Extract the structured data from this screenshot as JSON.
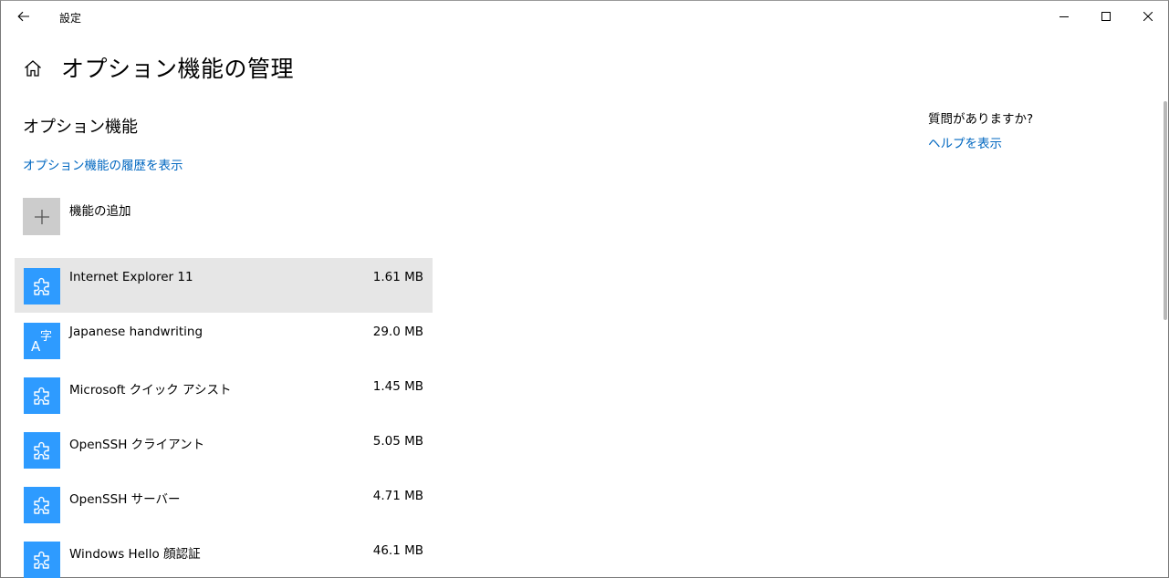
{
  "window": {
    "title": "設定",
    "controls": {
      "minimize_icon": "minimize-icon",
      "maximize_icon": "maximize-icon",
      "close_icon": "close-icon"
    }
  },
  "page": {
    "title": "オプション機能の管理",
    "section_title": "オプション機能",
    "history_link": "オプション機能の履歴を表示",
    "add_feature_label": "機能の追加"
  },
  "features": [
    {
      "name": "Internet Explorer 11",
      "size": "1.61 MB",
      "icon": "puzzle-icon",
      "selected": true
    },
    {
      "name": "Japanese handwriting",
      "size": "29.0 MB",
      "icon": "language-icon",
      "selected": false
    },
    {
      "name": "Microsoft クイック アシスト",
      "size": "1.45 MB",
      "icon": "puzzle-icon",
      "selected": false
    },
    {
      "name": "OpenSSH クライアント",
      "size": "5.05 MB",
      "icon": "puzzle-icon",
      "selected": false
    },
    {
      "name": "OpenSSH サーバー",
      "size": "4.71 MB",
      "icon": "puzzle-icon",
      "selected": false
    },
    {
      "name": "Windows Hello 顔認証",
      "size": "46.1 MB",
      "icon": "puzzle-icon",
      "selected": false
    }
  ],
  "help": {
    "title": "質問がありますか?",
    "link": "ヘルプを表示"
  },
  "colors": {
    "accent": "#2e9bff",
    "link": "#0067c0",
    "selected_row": "#e6e6e6",
    "add_tile": "#cccccc"
  }
}
